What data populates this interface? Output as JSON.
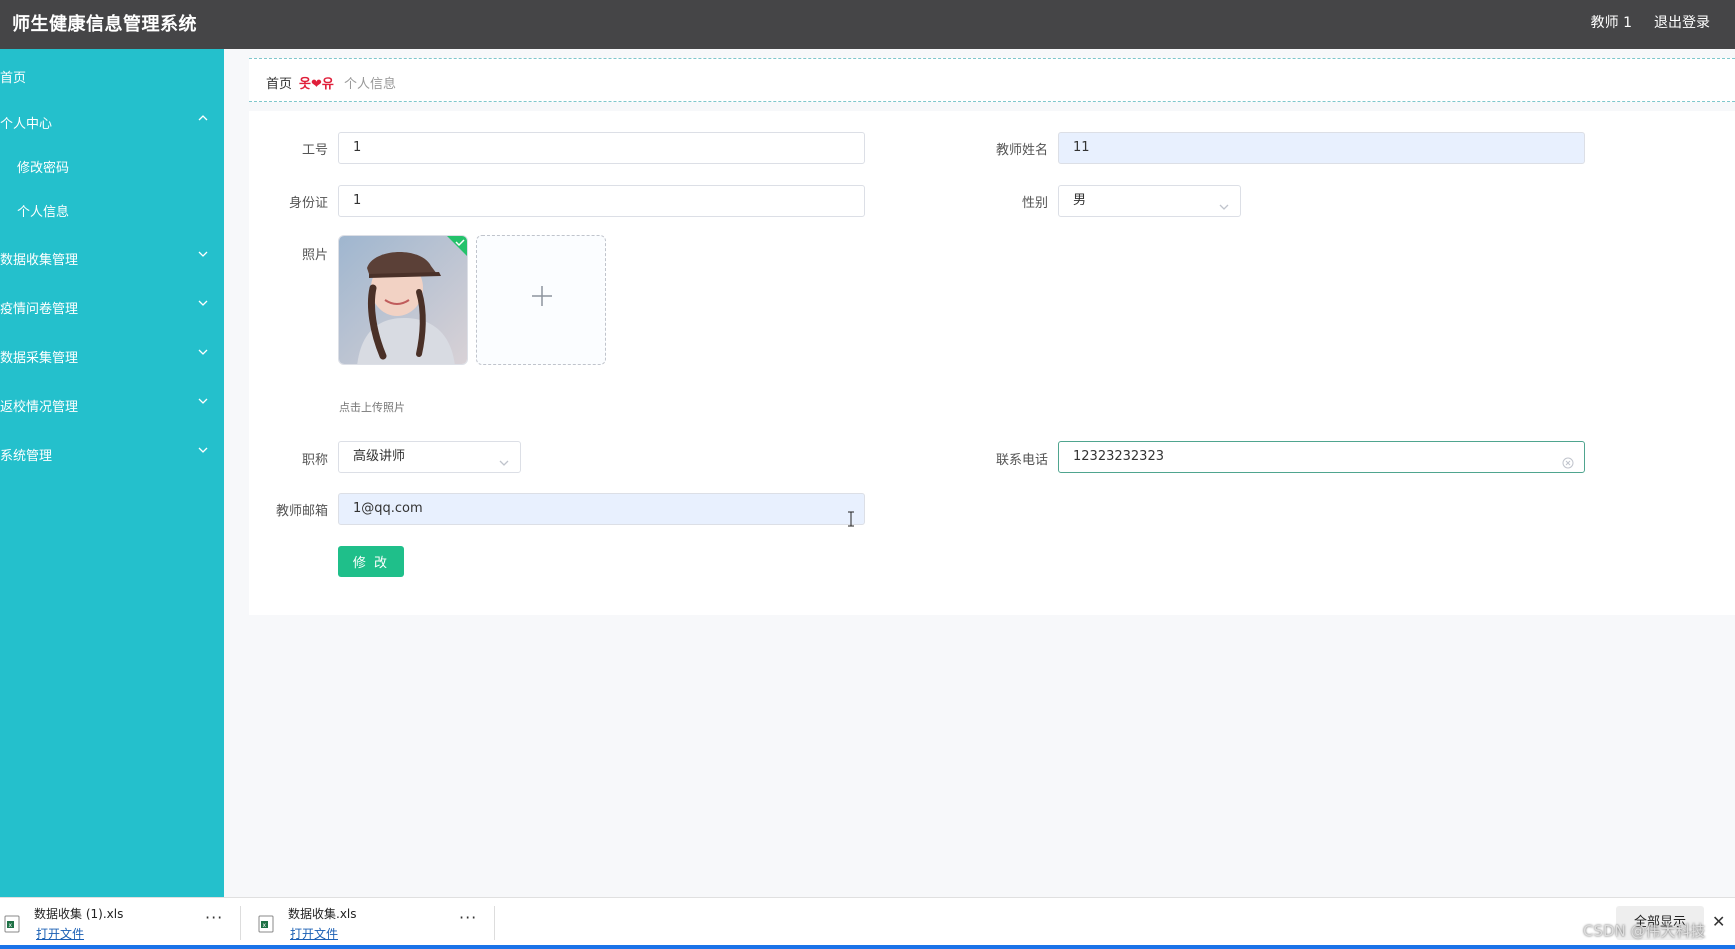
{
  "header": {
    "title": "师生健康信息管理系统",
    "user": "教师 1",
    "logout": "退出登录"
  },
  "sidebar": {
    "items": [
      {
        "label": "首页",
        "icon": ""
      },
      {
        "label": "个人中心",
        "icon": "chevron-up-icon"
      },
      {
        "label": "修改密码",
        "icon": ""
      },
      {
        "label": "个人信息",
        "icon": ""
      },
      {
        "label": "数据收集管理",
        "icon": "chevron-down-icon"
      },
      {
        "label": "疫情问卷管理",
        "icon": "chevron-down-icon"
      },
      {
        "label": "数据采集管理",
        "icon": "chevron-down-icon"
      },
      {
        "label": "返校情况管理",
        "icon": "chevron-down-icon"
      },
      {
        "label": "系统管理",
        "icon": "chevron-down-icon"
      }
    ]
  },
  "breadcrumb": {
    "home": "首页",
    "separator": "옷❤유",
    "current": "个人信息"
  },
  "form": {
    "id_label": "工号",
    "id_value": "1",
    "name_label": "教师姓名",
    "name_value": "11",
    "idcard_label": "身份证",
    "idcard_value": "1",
    "gender_label": "性别",
    "gender_value": "男",
    "photo_label": "照片",
    "upload_tip": "点击上传照片",
    "title_label": "职称",
    "title_value": "高级讲师",
    "phone_label": "联系电话",
    "phone_value": "12323232323",
    "email_label": "教师邮箱",
    "email_value": "1@qq.com",
    "submit": "修 改"
  },
  "downloads": {
    "items": [
      {
        "name": "数据收集 (1).xls",
        "action": "打开文件"
      },
      {
        "name": "数据收集.xls",
        "action": "打开文件"
      }
    ],
    "show_all": "全部显示",
    "more": "···"
  },
  "watermark": "CSDN @伟大科技",
  "colors": {
    "sidebar": "#24c0cc",
    "header": "#454547",
    "primary_button": "#1fbf8a",
    "breadcrumb_separator": "#e01f3a"
  }
}
